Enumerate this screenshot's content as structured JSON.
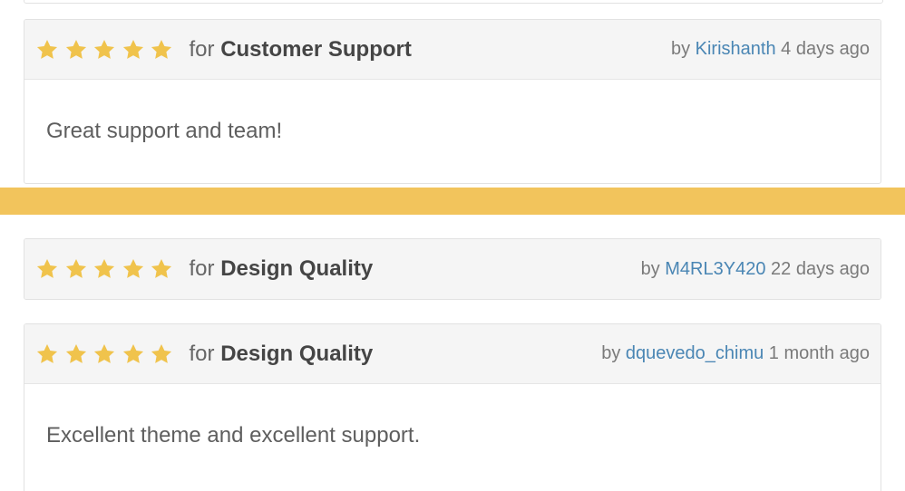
{
  "colors": {
    "star": "#f0c34c",
    "accent_bar": "#f2c45c",
    "link": "#4a86b4",
    "header_bg": "#f5f5f5"
  },
  "rating_icon": "star-icon",
  "reviews": [
    {
      "stars": 5,
      "for_label": "for",
      "category": "Customer Support",
      "by_label": "by",
      "author": "Kirishanth",
      "time_ago": "4 days ago",
      "body": "Great support and team!"
    },
    {
      "stars": 5,
      "for_label": "for",
      "category": "Design Quality",
      "by_label": "by",
      "author": "M4RL3Y420",
      "time_ago": "22 days ago",
      "body": ""
    },
    {
      "stars": 5,
      "for_label": "for",
      "category": "Design Quality",
      "by_label": "by",
      "author": "dquevedo_chimu",
      "time_ago": "1 month ago",
      "body": "Excellent theme and excellent support."
    }
  ]
}
